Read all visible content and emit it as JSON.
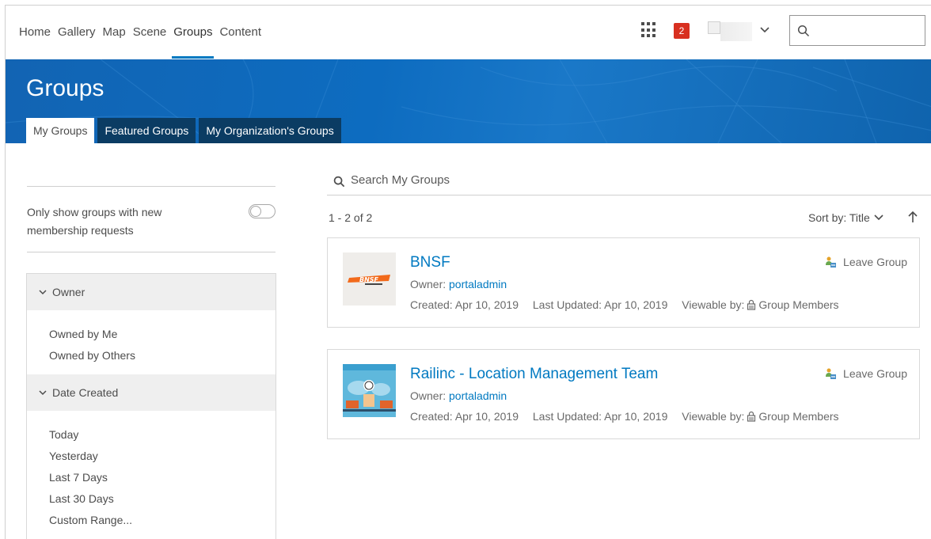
{
  "nav": {
    "links": [
      "Home",
      "Gallery",
      "Map",
      "Scene",
      "Groups",
      "Content"
    ],
    "active": "Groups",
    "notification_count": "2",
    "icons": {
      "apps": "apps-grid-icon",
      "search": "search-icon",
      "user_menu": "chevron-down-icon"
    }
  },
  "banner": {
    "title": "Groups",
    "tabs": [
      "My Groups",
      "Featured Groups",
      "My Organization's Groups"
    ],
    "active_tab": "My Groups"
  },
  "filters": {
    "toggle_label": "Only show groups with new membership requests",
    "toggle_on": false,
    "facets": [
      {
        "title": "Owner",
        "items": [
          "Owned by Me",
          "Owned by Others"
        ]
      },
      {
        "title": "Date Created",
        "items": [
          "Today",
          "Yesterday",
          "Last 7 Days",
          "Last 30 Days",
          "Custom Range..."
        ]
      }
    ]
  },
  "results": {
    "search_placeholder": "Search My Groups",
    "count_text": "1 - 2 of 2",
    "sort_label": "Sort by: Title",
    "cards": [
      {
        "title": "BNSF",
        "owner_label": "Owner: ",
        "owner": "portaladmin",
        "created": "Created: Apr 10, 2019",
        "updated": "Last Updated: Apr 10, 2019",
        "viewable_label": "Viewable by:",
        "viewable_value": "Group Members",
        "action": "Leave Group"
      },
      {
        "title": "Railinc - Location Management Team",
        "owner_label": "Owner: ",
        "owner": "portaladmin",
        "created": "Created: Apr 10, 2019",
        "updated": "Last Updated: Apr 10, 2019",
        "viewable_label": "Viewable by:",
        "viewable_value": "Group Members",
        "action": "Leave Group"
      }
    ]
  },
  "colors": {
    "accent": "#0079c1",
    "banner": "#0d6cc0",
    "tab_dark": "#0b3c63",
    "badge": "#d83020"
  }
}
